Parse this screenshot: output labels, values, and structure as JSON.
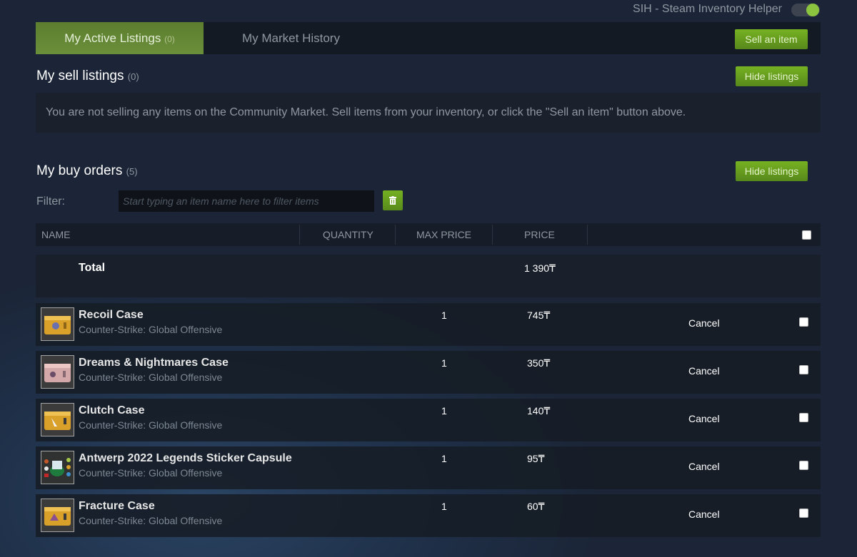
{
  "extension": {
    "label": "SIH - Steam Inventory Helper",
    "toggle_on": true,
    "toggle_color": "#8bc53f"
  },
  "tabs": [
    {
      "label": "My Active Listings",
      "count": "(0)",
      "active": true
    },
    {
      "label": "My Market History",
      "active": false
    }
  ],
  "toolbar": {
    "sell_item_label": "Sell an item"
  },
  "sell_listings": {
    "title": "My sell listings",
    "count": "(0)",
    "hide_label": "Hide listings",
    "empty_message": "You are not selling any items on the Community Market. Sell items from your inventory, or click the \"Sell an item\" button above."
  },
  "buy_orders": {
    "title": "My buy orders",
    "count": "(5)",
    "hide_label": "Hide listings",
    "filter_label": "Filter:",
    "filter_placeholder": "Start typing an item name here to filter items",
    "filter_value": "",
    "columns": [
      "NAME",
      "QUANTITY",
      "MAX PRICE",
      "PRICE"
    ],
    "total_label": "Total",
    "total_value": "1 390₸",
    "cancel_label": "Cancel",
    "rows": [
      {
        "name": "Recoil Case",
        "game": "Counter-Strike: Global Offensive",
        "quantity": "1",
        "price": "745₸",
        "thumb": "yellow-case-icon"
      },
      {
        "name": "Dreams & Nightmares Case",
        "game": "Counter-Strike: Global Offensive",
        "quantity": "1",
        "price": "350₸",
        "thumb": "pink-case-icon"
      },
      {
        "name": "Clutch Case",
        "game": "Counter-Strike: Global Offensive",
        "quantity": "1",
        "price": "140₸",
        "thumb": "yellow-case-icon"
      },
      {
        "name": "Antwerp 2022 Legends Sticker Capsule",
        "game": "Counter-Strike: Global Offensive",
        "quantity": "1",
        "price": "95₸",
        "thumb": "sticker-capsule-icon"
      },
      {
        "name": "Fracture Case",
        "game": "Counter-Strike: Global Offensive",
        "quantity": "1",
        "price": "60₸",
        "thumb": "yellow-case-icon"
      }
    ]
  },
  "colors": {
    "accent_green": "#75b022",
    "background": "#1b2537",
    "panel": "#161d28"
  }
}
